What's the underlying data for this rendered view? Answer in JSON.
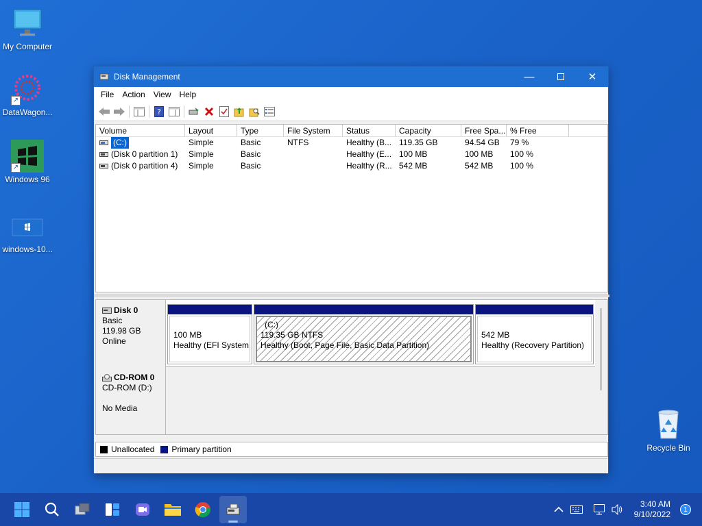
{
  "desktop": {
    "icons": [
      {
        "label": "My Computer"
      },
      {
        "label": "DataWagon..."
      },
      {
        "label": "Windows 96"
      },
      {
        "label": "windows-10..."
      },
      {
        "label": "Recycle Bin"
      }
    ]
  },
  "window": {
    "title": "Disk Management",
    "menu": [
      "File",
      "Action",
      "View",
      "Help"
    ],
    "columns": [
      "Volume",
      "Layout",
      "Type",
      "File System",
      "Status",
      "Capacity",
      "Free Spa...",
      "% Free"
    ],
    "volumes": [
      {
        "volume": "(C:)",
        "layout": "Simple",
        "type": "Basic",
        "fs": "NTFS",
        "status": "Healthy (B...",
        "capacity": "119.35 GB",
        "free": "94.54 GB",
        "pct": "79 %"
      },
      {
        "volume": "(Disk 0 partition 1)",
        "layout": "Simple",
        "type": "Basic",
        "fs": "",
        "status": "Healthy (E...",
        "capacity": "100 MB",
        "free": "100 MB",
        "pct": "100 %"
      },
      {
        "volume": "(Disk 0 partition 4)",
        "layout": "Simple",
        "type": "Basic",
        "fs": "",
        "status": "Healthy (R...",
        "capacity": "542 MB",
        "free": "542 MB",
        "pct": "100 %"
      }
    ],
    "disk0": {
      "name": "Disk 0",
      "type": "Basic",
      "size": "119.98 GB",
      "state": "Online",
      "partitions": [
        {
          "line1": "100 MB",
          "line2": "Healthy (EFI System P"
        },
        {
          "title": "(C:)",
          "line1": "119.35 GB NTFS",
          "line2": "Healthy (Boot, Page File, Basic Data Partition)"
        },
        {
          "line1": "542 MB",
          "line2": "Healthy (Recovery Partition)"
        }
      ]
    },
    "cdrom0": {
      "name": "CD-ROM 0",
      "drive": "CD-ROM (D:)",
      "media": "No Media"
    },
    "legend": {
      "unallocated": "Unallocated",
      "primary": "Primary partition"
    }
  },
  "taskbar": {
    "time": "3:40 AM",
    "date": "9/10/2022",
    "notification_count": "1"
  },
  "colors": {
    "desktop": "#1a62c8",
    "titlebar": "#1f6fd2",
    "partition_bar": "#0a1580",
    "selection": "#0a64d2",
    "taskbar": "#1847a8"
  }
}
